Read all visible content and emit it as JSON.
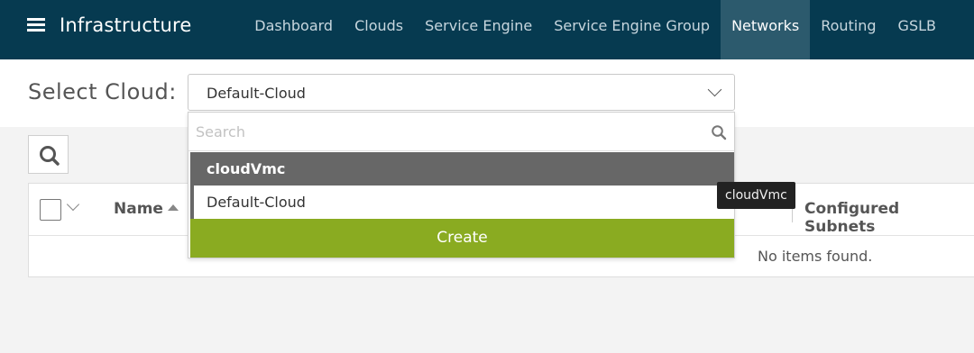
{
  "header": {
    "title": "Infrastructure",
    "menu_icon": "hamburger-menu-icon",
    "tabs": [
      {
        "label": "Dashboard",
        "active": false
      },
      {
        "label": "Clouds",
        "active": false
      },
      {
        "label": "Service Engine",
        "active": false
      },
      {
        "label": "Service Engine Group",
        "active": false
      },
      {
        "label": "Networks",
        "active": true
      },
      {
        "label": "Routing",
        "active": false
      },
      {
        "label": "GSLB",
        "active": false
      }
    ]
  },
  "cloud_selector": {
    "label": "Select Cloud:",
    "selected": "Default-Cloud"
  },
  "dropdown": {
    "search_placeholder": "Search",
    "items": [
      {
        "label": "cloudVmc",
        "highlighted": true
      },
      {
        "label": "Default-Cloud",
        "highlighted": false
      }
    ],
    "create_label": "Create"
  },
  "tooltip": {
    "text": "cloudVmc"
  },
  "table": {
    "columns": [
      "Name",
      "Configured Subnets"
    ],
    "empty_message": "No items found."
  },
  "colors": {
    "header_bg": "#063a50",
    "active_tab_bg": "#2c5a6d",
    "create_button": "#8aab21",
    "highlight_item": "#676767"
  }
}
